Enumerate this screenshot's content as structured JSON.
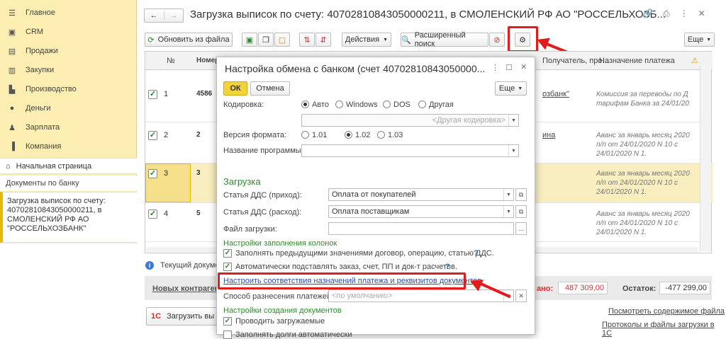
{
  "sidebar": {
    "items": [
      {
        "label": "Главное",
        "icon": "menu-icon"
      },
      {
        "label": "CRM",
        "icon": "crm-icon"
      },
      {
        "label": "Продажи",
        "icon": "cart-icon"
      },
      {
        "label": "Закупки",
        "icon": "purchases-icon"
      },
      {
        "label": "Производство",
        "icon": "factory-icon"
      },
      {
        "label": "Деньги",
        "icon": "money-icon"
      },
      {
        "label": "Зарплата",
        "icon": "person-icon"
      },
      {
        "label": "Компания",
        "icon": "company-icon"
      }
    ],
    "home": "Начальная страница",
    "docs_bank": "Документы по банку",
    "open_doc": "Загрузка выписок по счету:\n40702810843050000211, в\nСМОЛЕНСКИЙ РФ АО\n\"РОССЕЛЬХОЗБАНК\""
  },
  "main": {
    "title": "Загрузка выписок по счету: 40702810843050000211, в СМОЛЕНСКИЙ РФ АО \"РОССЕЛЬХОЗБ...",
    "refresh": "Обновить из файла",
    "actions": "Действия",
    "adv_search": "Расширенный поиск",
    "more": "Еще",
    "col_num": "№",
    "col_number": "Номер",
    "col_payer": "Получатель, про...",
    "col_purpose": "Назначение платежа",
    "rows": [
      {
        "n": "1",
        "num": "4586",
        "link": "озбанк\"",
        "purpose": "Комиссия за переводы по Д\nтарифам Банка за 24/01/20"
      },
      {
        "n": "2",
        "num": "2",
        "link": "ина",
        "purpose": "Аванс за январь месяц 2020\nп/п от 24/01/2020 N 10 с\n24/01/2020 N 1."
      },
      {
        "n": "3",
        "num": "3",
        "link": "",
        "purpose": "Аванс за январь месяц 2020\nп/п от 24/01/2020 N 10 с\n24/01/2020 N 1."
      },
      {
        "n": "4",
        "num": "5",
        "link": "",
        "purpose": "Аванс за январь месяц 2020\nп/п от 24/01/2020 N 10 с\n24/01/2020 N 1."
      }
    ],
    "current_doc": "Текущий докумен",
    "new_contractors": "Новых контрагент",
    "sum_label": "ано:",
    "sum_value": "487 309,00",
    "balance_label": "Остаток:",
    "balance_value": "-477 299,00",
    "load_btn": "Загрузить вы",
    "view_file": "Посмотреть содержимое файла",
    "protocols": "Протоколы и файлы загрузки в 1С"
  },
  "dialog": {
    "title": "Настройка обмена с банком (счет 40702810843050000...",
    "ok": "ОК",
    "cancel": "Отмена",
    "more": "Еще",
    "encoding_label": "Кодировка:",
    "enc_options": [
      "Авто",
      "Windows",
      "DOS",
      "Другая"
    ],
    "other_encoding_placeholder": "<Другая кодировка>",
    "version_label": "Версия формата:",
    "version_options": [
      "1.01",
      "1.02",
      "1.03"
    ],
    "program_label": "Название программы:",
    "section_load": "Загрузка",
    "dds_in_label": "Статья ДДС (приход):",
    "dds_in_value": "Оплата от покупателей",
    "dds_out_label": "Статья ДДС (расход):",
    "dds_out_value": "Оплата поставщикам",
    "file_label": "Файл загрузки:",
    "fill_section": "Настройки заполнения колонок",
    "fill_chk1": "Заполнять предыдущими значениями договор, операцию, статью ДДС.",
    "fill_chk2": "Автоматически подставлять заказ, счет, ПП и док-т расчетов.",
    "help": "?",
    "link_setup": "Настроить соответствия назначений платежа и реквизитов документов",
    "distribution_label": "Способ разнесения платежей:",
    "distribution_placeholder": "<по умолчанию>",
    "create_section": "Настройки создания документов",
    "create_chk1": "Проводить загружаемые",
    "create_chk2": "Заполнять долги автоматически"
  }
}
